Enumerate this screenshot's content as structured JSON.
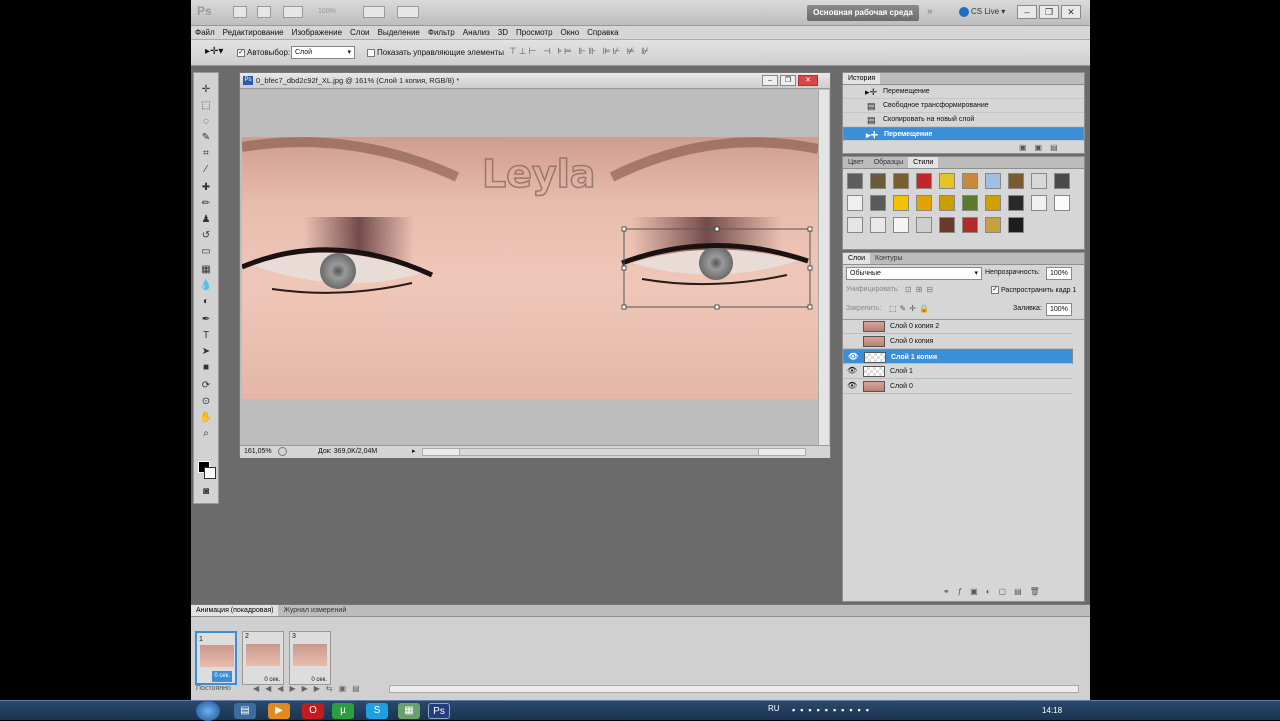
{
  "appbar": {
    "logo": "Ps",
    "zoom": "100%",
    "workspace": "Основная рабочая среда",
    "chevron": "»",
    "cs_live": "CS Live"
  },
  "menu": [
    "Файл",
    "Редактирование",
    "Изображение",
    "Слои",
    "Выделение",
    "Фильтр",
    "Анализ",
    "3D",
    "Просмотр",
    "Окно",
    "Справка"
  ],
  "options": {
    "autoselect_label": "Автовыбор:",
    "autoselect_value": "Слой",
    "show_controls": "Показать управляющие элементы"
  },
  "document": {
    "title": "0_bfec7_dbd2c92f_XL.jpg @ 161% (Слой 1 копия, RGB/8) *",
    "text_on_image": "Leyla",
    "zoom": "161,05%",
    "doc_info": "Док: 369,0K/2,04M"
  },
  "history": {
    "tab": "История",
    "items": [
      "Перемещение",
      "Свободное трансформирование",
      "Скопировать на новый слой",
      "Перемещение"
    ]
  },
  "styles": {
    "tabs": [
      "Цвет",
      "Образцы",
      "Стили"
    ],
    "swatches": [
      "#5d5d5d",
      "#6b5a3a",
      "#7a5e32",
      "#c2262b",
      "#e4c22a",
      "#c88a3a",
      "#9fc0e0",
      "#7b5a2e",
      "#d8d8d8",
      "#4a4a4a",
      "#efefef",
      "#5a5a5a",
      "#f2c200",
      "#e2a300",
      "#c9a000",
      "#5a7a2c",
      "#d0a000",
      "#2a2a2a",
      "#f0f0f0",
      "#fafafa",
      "#e6e6e6",
      "#e8e8e8",
      "#f4f4f4",
      "#cfcfcf",
      "#6a3a2a",
      "#b22a2a",
      "#c8a040",
      "#1e1e1e"
    ]
  },
  "layers": {
    "tabs": [
      "Слои",
      "Контуры"
    ],
    "blend": "Обычные",
    "opacity_label": "Непрозрачность:",
    "opacity": "100%",
    "unify_label": "Унифицировать:",
    "propagate": "Распространить кадр 1",
    "lock_label": "Закрепить:",
    "fill_label": "Заливка:",
    "fill": "100%",
    "items": [
      {
        "name": "Слой 0 копия 2",
        "visible": false,
        "type": "photo"
      },
      {
        "name": "Слой 0 копия",
        "visible": false,
        "type": "photo"
      },
      {
        "name": "Слой 1 копия",
        "visible": true,
        "type": "transparent"
      },
      {
        "name": "Слой 1",
        "visible": true,
        "type": "transparent"
      },
      {
        "name": "Слой 0",
        "visible": true,
        "type": "photo"
      }
    ]
  },
  "animation": {
    "tabs": [
      "Анимация (покадровая)",
      "Журнал измерений"
    ],
    "frames": [
      {
        "num": "1",
        "delay": "0 сек."
      },
      {
        "num": "2",
        "delay": "0 сек."
      },
      {
        "num": "3",
        "delay": "0 сек."
      }
    ],
    "loop": "Постоянно"
  },
  "taskbar": {
    "lang": "RU",
    "time": "14:18"
  },
  "colors": {
    "accent": "#3b8fd9",
    "workspace_bg": "#6b6b6b"
  }
}
